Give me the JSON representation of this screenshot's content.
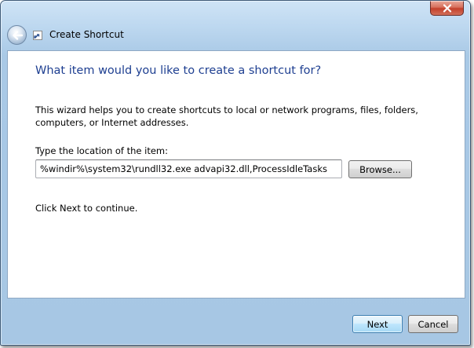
{
  "window": {
    "title": "Create Shortcut"
  },
  "wizard": {
    "heading": "What item would you like to create a shortcut for?",
    "description": "This wizard helps you to create shortcuts to local or network programs, files, folders, computers, or Internet addresses.",
    "location_label": "Type the location of the item:",
    "location_value": "%windir%\\system32\\rundll32.exe advapi32.dll,ProcessIdleTasks",
    "browse_label": "Browse...",
    "continue_text": "Click Next to continue."
  },
  "buttons": {
    "next_label": "Next",
    "cancel_label": "Cancel"
  },
  "icons": {
    "close": "close-icon",
    "back": "back-arrow-icon",
    "app": "shortcut-icon"
  },
  "colors": {
    "heading": "#1e3f91",
    "frame": "#a9c9e6",
    "close_button": "#c3402a"
  }
}
